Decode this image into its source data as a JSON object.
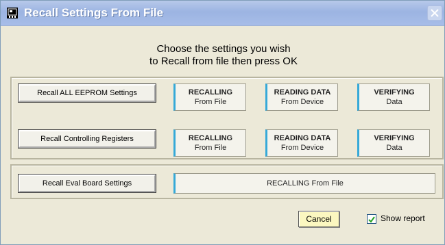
{
  "window": {
    "title": "Recall Settings From File"
  },
  "instructions": {
    "line1": "Choose the settings you wish",
    "line2": "to Recall from file then press OK"
  },
  "rows": {
    "eeprom": {
      "button": "Recall ALL EEPROM Settings",
      "status": [
        {
          "l1": "RECALLING",
          "l2": "From File"
        },
        {
          "l1": "READING DATA",
          "l2": "From Device"
        },
        {
          "l1": "VERIFYING",
          "l2": "Data"
        }
      ]
    },
    "controlling": {
      "button": "Recall Controlling Registers",
      "status": [
        {
          "l1": "RECALLING",
          "l2": "From File"
        },
        {
          "l1": "READING DATA",
          "l2": "From Device"
        },
        {
          "l1": "VERIFYING",
          "l2": "Data"
        }
      ]
    },
    "evalboard": {
      "button": "Recall Eval Board Settings",
      "status": "RECALLING From File"
    }
  },
  "footer": {
    "cancel_label": "Cancel",
    "show_report_label": "Show report",
    "show_report_checked": true
  },
  "colors": {
    "status_accent": "#35a9d8",
    "cancel_bg": "#fbf7c0"
  }
}
